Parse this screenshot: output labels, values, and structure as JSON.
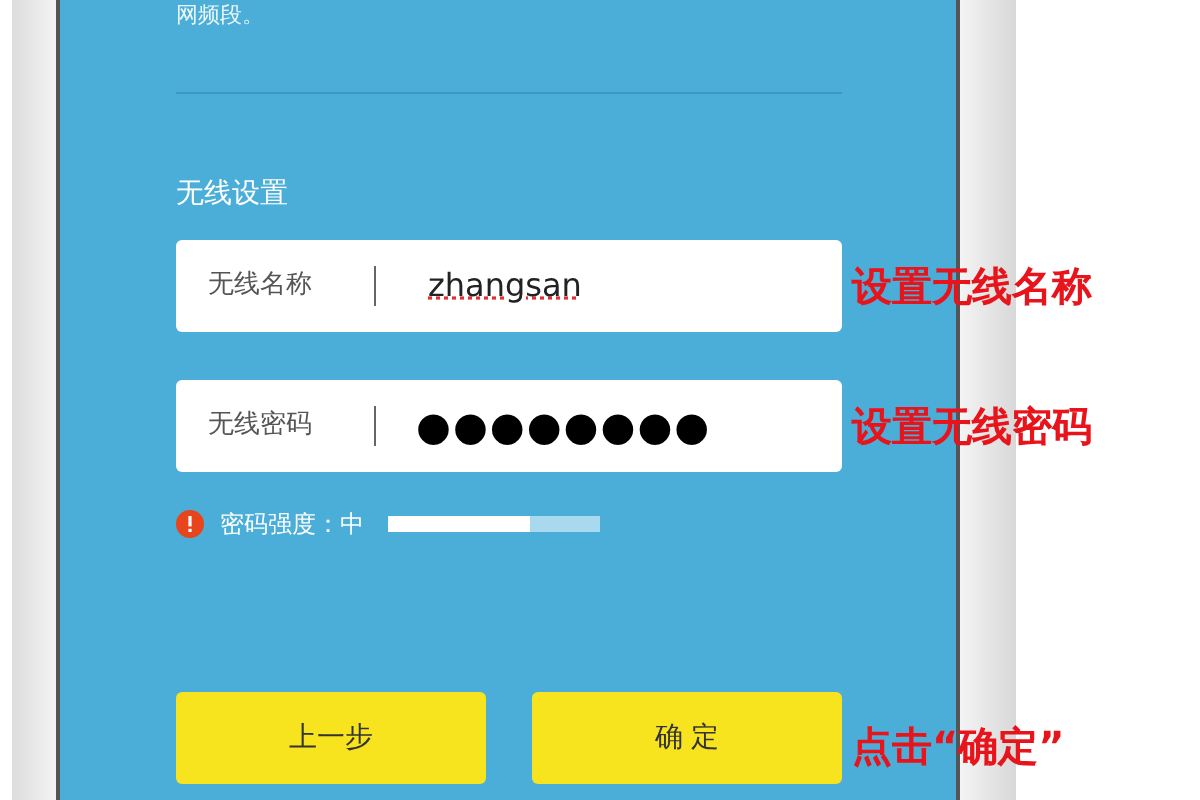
{
  "intro_text": "网频段。",
  "section_title": "无线设置",
  "fields": [
    {
      "label": "无线名称",
      "value": "zhangsan",
      "kind": "text"
    },
    {
      "label": "无线密码",
      "value": "●●●●●●●●",
      "kind": "password"
    }
  ],
  "password_strength": {
    "label": "密码强度：中",
    "level": 0.67
  },
  "buttons": [
    {
      "label": "上一步"
    },
    {
      "label": "确 定"
    }
  ],
  "annotations": [
    "设置无线名称",
    "设置无线密码",
    "点击“确定”"
  ]
}
